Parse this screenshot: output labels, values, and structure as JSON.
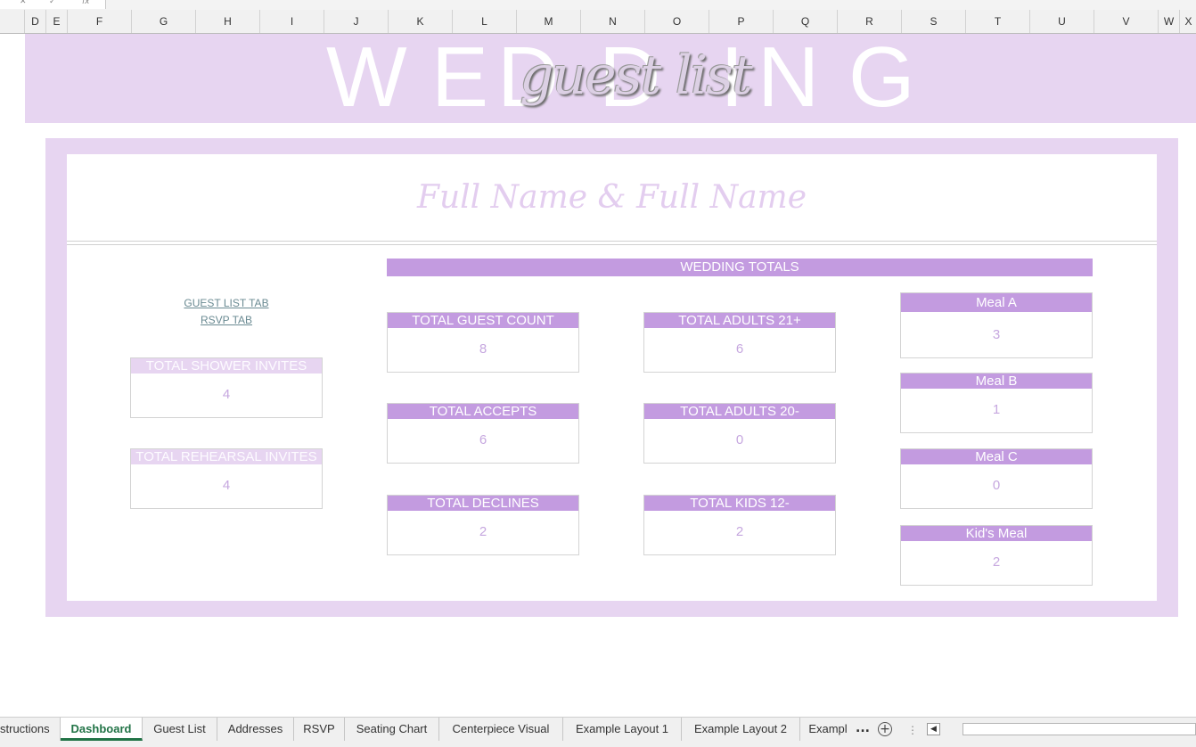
{
  "formula_bar": {
    "fx_label": "fx"
  },
  "columns": [
    "D",
    "E",
    "F",
    "G",
    "H",
    "I",
    "J",
    "K",
    "L",
    "M",
    "N",
    "O",
    "P",
    "Q",
    "R",
    "S",
    "T",
    "U",
    "V",
    "W",
    "X"
  ],
  "banner": {
    "letters": [
      "W",
      "E",
      "D",
      "D",
      "I",
      "N",
      "G"
    ],
    "subtitle": "guest list"
  },
  "couple_name": "Full Name & Full Name",
  "links": {
    "guest_list": "GUEST LIST TAB",
    "rsvp": "RSVP TAB"
  },
  "totals_header": "WEDDING TOTALS",
  "left_cards": [
    {
      "label": "TOTAL SHOWER INVITES",
      "value": "4"
    },
    {
      "label": "TOTAL REHEARSAL INVITES",
      "value": "4"
    }
  ],
  "center_cards": [
    {
      "label": "TOTAL GUEST COUNT",
      "value": "8"
    },
    {
      "label": "TOTAL ACCEPTS",
      "value": "6"
    },
    {
      "label": "TOTAL DECLINES",
      "value": "2"
    }
  ],
  "right_cards": [
    {
      "label": "TOTAL ADULTS 21+",
      "value": "6"
    },
    {
      "label": "TOTAL ADULTS 20-",
      "value": "0"
    },
    {
      "label": "TOTAL KIDS 12-",
      "value": "2"
    }
  ],
  "meal_cards": [
    {
      "label": "Meal A",
      "value": "3"
    },
    {
      "label": "Meal B",
      "value": "1"
    },
    {
      "label": "Meal C",
      "value": "0"
    },
    {
      "label": "Kid's Meal",
      "value": "2"
    }
  ],
  "tabs": [
    {
      "label": "structions"
    },
    {
      "label": "Dashboard",
      "active": true
    },
    {
      "label": "Guest List"
    },
    {
      "label": "Addresses"
    },
    {
      "label": "RSVP"
    },
    {
      "label": "Seating Chart"
    },
    {
      "label": "Centerpiece Visual"
    },
    {
      "label": "Example Layout 1"
    },
    {
      "label": "Example Layout 2"
    },
    {
      "label": "Exampl"
    }
  ],
  "tab_overflow": "...",
  "add_sheet_symbol": "+",
  "scroll_left_symbol": "◀",
  "colors": {
    "accent": "#c39be0",
    "light": "#e7d5f1",
    "value_text": "#c6a7df",
    "active_tab": "#217346"
  }
}
